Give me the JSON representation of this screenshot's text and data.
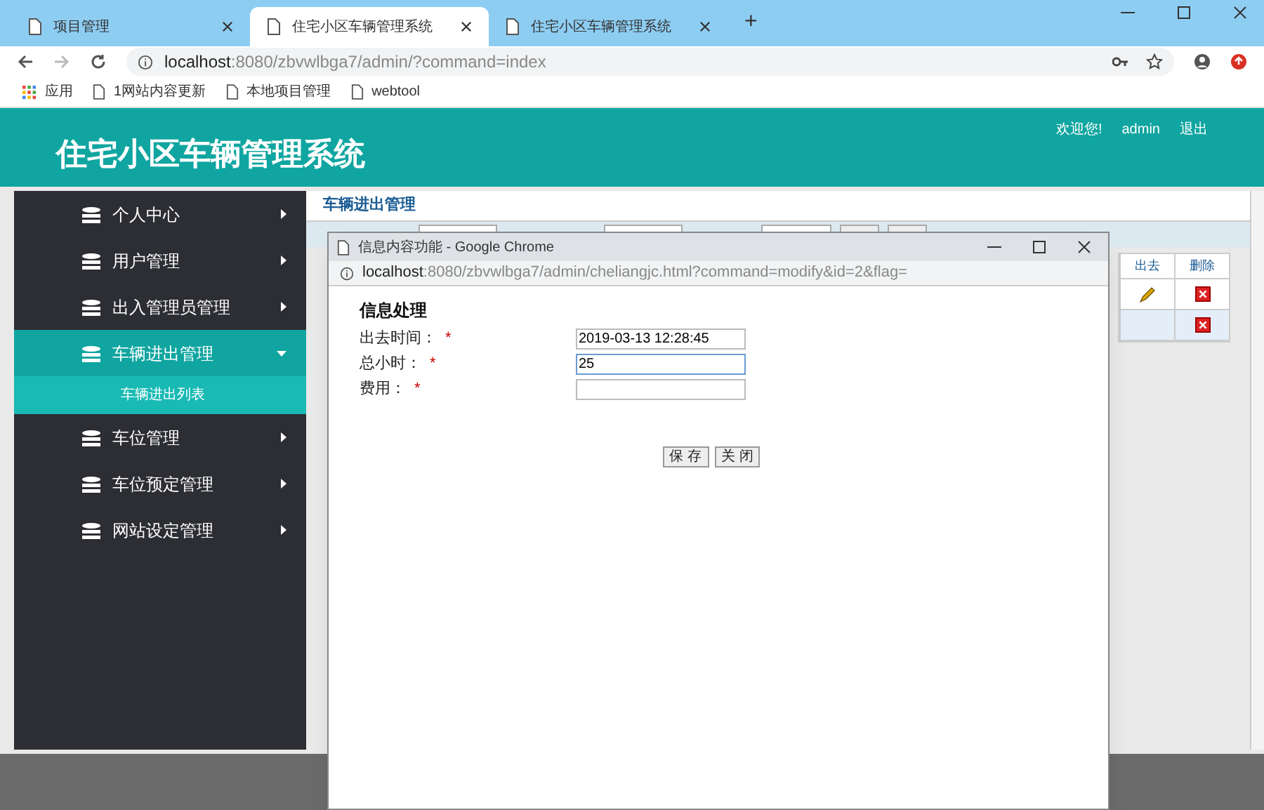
{
  "browser": {
    "tabs": [
      {
        "title": "项目管理",
        "selected": false
      },
      {
        "title": "住宅小区车辆管理系统",
        "selected": true
      },
      {
        "title": "住宅小区车辆管理系统",
        "selected": false
      }
    ],
    "new_tab": "+",
    "url_host": "localhost",
    "url_rest": ":8080/zbvwlbga7/admin/?command=index",
    "bookmarks": [
      {
        "kind": "apps",
        "label": "应用"
      },
      {
        "kind": "page",
        "label": "1网站内容更新"
      },
      {
        "kind": "page",
        "label": "本地项目管理"
      },
      {
        "kind": "page",
        "label": "webtool"
      }
    ]
  },
  "header": {
    "title": "住宅小区车辆管理系统",
    "welcome": "欢迎您!",
    "user": "admin",
    "logout": "退出"
  },
  "sidebar": {
    "items": [
      {
        "label": "个人中心",
        "expanded": false,
        "selected": false
      },
      {
        "label": "用户管理",
        "expanded": false,
        "selected": false
      },
      {
        "label": "出入管理员管理",
        "expanded": false,
        "selected": false
      },
      {
        "label": "车辆进出管理",
        "expanded": true,
        "selected": true,
        "children": [
          {
            "label": "车辆进出列表"
          }
        ]
      },
      {
        "label": "车位管理",
        "expanded": false,
        "selected": false
      },
      {
        "label": "车位预定管理",
        "expanded": false,
        "selected": false
      },
      {
        "label": "网站设定管理",
        "expanded": false,
        "selected": false
      }
    ]
  },
  "main": {
    "title": "车辆进出管理",
    "table": {
      "columns": [
        "出去",
        "删除"
      ],
      "rows": [
        {
          "selected": false
        },
        {
          "selected": true
        }
      ]
    }
  },
  "popup": {
    "title": "信息内容功能 - Google Chrome",
    "url_host": "localhost",
    "url_rest": ":8080/zbvwlbga7/admin/cheliangjc.html?command=modify&id=2&flag=",
    "heading": "信息处理",
    "fields": [
      {
        "label": "出去时间：",
        "required": "*",
        "value": "2019-03-13 12:28:45",
        "focused": false
      },
      {
        "label": "总小时：",
        "required": "*",
        "value": "25",
        "focused": true
      },
      {
        "label": "费用：",
        "required": "*",
        "focused": false
      }
    ],
    "buttons": [
      "保 存",
      "关 闭"
    ]
  }
}
